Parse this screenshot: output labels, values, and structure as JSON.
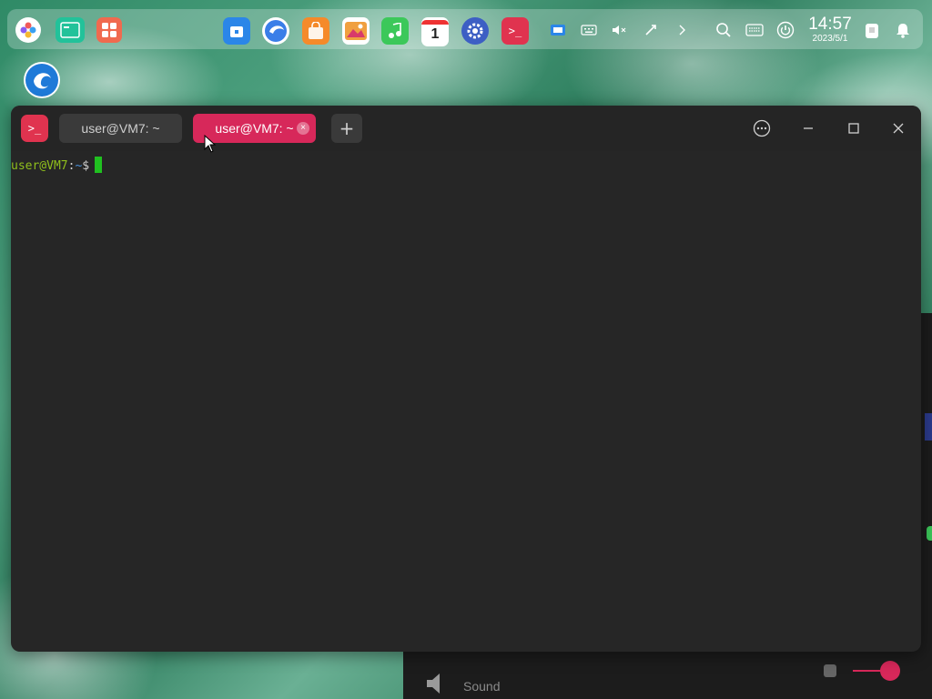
{
  "dock": {
    "apps": [
      {
        "name": "launcher-icon",
        "color": "#ffffff"
      },
      {
        "name": "multitask-view-icon",
        "color": "#22c29a"
      },
      {
        "name": "workspace-icon",
        "color": "#f06a4f"
      },
      {
        "name": "file-manager-icon",
        "color": "#2b86e8"
      },
      {
        "name": "browser-icon",
        "color": "#3a7ee8"
      },
      {
        "name": "app-store-icon",
        "color": "#f58a2a"
      },
      {
        "name": "image-viewer-icon",
        "color": "#f0a040"
      },
      {
        "name": "music-icon",
        "color": "#3cc85a"
      },
      {
        "name": "calendar-icon",
        "color": "#ffffff"
      },
      {
        "name": "settings-icon",
        "color": "#3d5fc4"
      },
      {
        "name": "terminal-app-icon",
        "color": "#e0334f"
      }
    ],
    "calendar_day": "1",
    "time": "14:57",
    "date": "2023/5/1"
  },
  "background_panel": {
    "sound_label": "Sound"
  },
  "terminal": {
    "tabs": [
      {
        "label": "user@VM7: ~",
        "active": false
      },
      {
        "label": "user@VM7: ~",
        "active": true
      }
    ],
    "add_tab_label": "+",
    "prompt_user": "user@VM7",
    "prompt_sep": ":",
    "prompt_path": "~",
    "prompt_symbol": "$",
    "accent": "#d7285a",
    "cursor_color": "#20c020"
  }
}
